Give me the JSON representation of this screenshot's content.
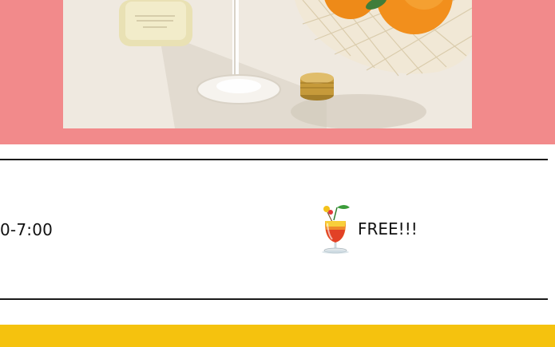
{
  "event": {
    "time_text": "0-7:00",
    "offer_text": "FREE!!!"
  },
  "icons": {
    "cocktail": "tropical-drink-icon"
  },
  "colors": {
    "banner_background": "#f28a8b",
    "divider": "#1a1a1a",
    "footer_band": "#f5c20e"
  }
}
